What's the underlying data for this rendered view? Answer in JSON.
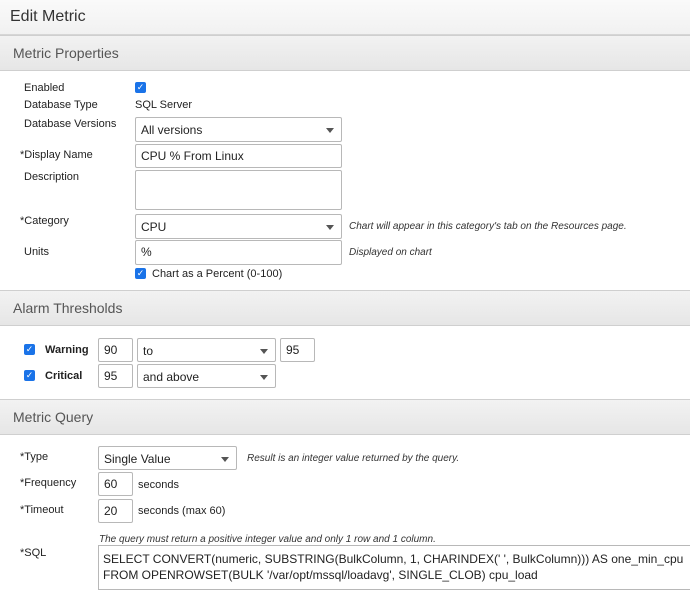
{
  "title": "Edit Metric",
  "sections": {
    "properties": "Metric Properties",
    "alarms": "Alarm Thresholds",
    "query": "Metric Query"
  },
  "properties": {
    "enabled_label": "Enabled",
    "enabled_checked": true,
    "db_type_label": "Database Type",
    "db_type_value": "SQL Server",
    "db_versions_label": "Database Versions",
    "db_versions_value": "All versions",
    "display_name_label": "*Display Name",
    "display_name_value": "CPU % From Linux",
    "description_label": "Description",
    "description_value": "",
    "category_label": "*Category",
    "category_value": "CPU",
    "category_note": "Chart will appear in this category's tab on the Resources page.",
    "units_label": "Units",
    "units_value": "%",
    "units_note": "Displayed on chart",
    "percent_label": "Chart as a Percent (0-100)",
    "percent_checked": true
  },
  "alarms": {
    "warning": {
      "label": "Warning",
      "checked": true,
      "value": "90",
      "operator": "to",
      "value2": "95"
    },
    "critical": {
      "label": "Critical",
      "checked": true,
      "value": "95",
      "operator": "and above"
    }
  },
  "query": {
    "type_label": "*Type",
    "type_value": "Single Value",
    "type_note": "Result is an integer value returned by the query.",
    "frequency_label": "*Frequency",
    "frequency_value": "60",
    "frequency_unit": "seconds",
    "timeout_label": "*Timeout",
    "timeout_value": "20",
    "timeout_unit": "seconds (max 60)",
    "sql_note": "The query must return a positive integer value and only 1 row and 1 column.",
    "sql_label": "*SQL",
    "sql_lines": [
      "SELECT CONVERT(numeric, SUBSTRING(BulkColumn, 1, CHARINDEX(' ', BulkColumn))) AS one_min_cpu",
      "FROM OPENROWSET(BULK '/var/opt/mssql/loadavg', SINGLE_CLOB) cpu_load"
    ]
  },
  "colors": {
    "accent": "#1a73e8",
    "section_bg": "#e9e9e9"
  }
}
